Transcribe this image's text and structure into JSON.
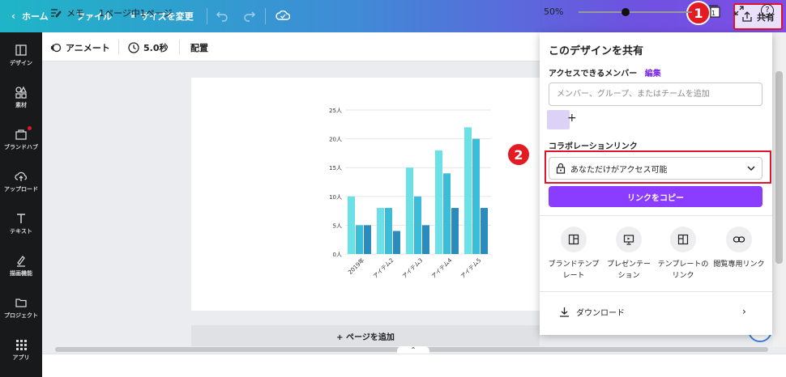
{
  "topbar": {
    "home": "ホーム",
    "file": "ファイル",
    "resize": "サイズを変更",
    "share": "共有",
    "badge1": "1",
    "badge2": "2"
  },
  "sidebar": {
    "items": [
      {
        "label": "デザイン",
        "icon": "layout-icon"
      },
      {
        "label": "素材",
        "icon": "shapes-icon"
      },
      {
        "label": "ブランドハブ",
        "icon": "brand-icon"
      },
      {
        "label": "アップロード",
        "icon": "upload-icon"
      },
      {
        "label": "テキスト",
        "icon": "text-icon"
      },
      {
        "label": "描画機能",
        "icon": "draw-icon"
      },
      {
        "label": "プロジェクト",
        "icon": "folder-icon"
      },
      {
        "label": "アプリ",
        "icon": "apps-icon"
      }
    ]
  },
  "subbar": {
    "animate": "アニメート",
    "duration": "5.0秒",
    "arrange": "配置"
  },
  "canvas": {
    "add_page": "+ ページを追加"
  },
  "bottombar": {
    "notes": "メモ",
    "page_info": "1ページ中1ページ",
    "zoom": "50%",
    "page_count": "1",
    "help": "?"
  },
  "share_panel": {
    "title": "このデザインを共有",
    "access_label": "アクセスできるメンバー",
    "edit_link": "編集",
    "search_placeholder": "メンバー、グループ、またはチームを追加",
    "collab_label": "コラボレーションリンク",
    "access_value": "あなただけがアクセス可能",
    "copy_button": "リンクをコピー",
    "options": [
      {
        "line1": "ブランドテンプ",
        "line2": "レート",
        "icon": "template-icon"
      },
      {
        "line1": "プレゼンテー",
        "line2": "ション",
        "icon": "present-icon"
      },
      {
        "line1": "テンプレートの",
        "line2": "リンク",
        "icon": "template-link-icon"
      },
      {
        "line1": "閲覧専用リンク",
        "line2": "",
        "icon": "link-icon"
      }
    ],
    "download": "ダウンロード"
  },
  "chart_data": {
    "type": "bar",
    "categories": [
      "2019年",
      "アイテム2",
      "アイテム3",
      "アイテム4",
      "アイテム5"
    ],
    "series": [
      {
        "values": [
          10,
          8,
          15,
          18,
          22
        ]
      },
      {
        "values": [
          5,
          8,
          10,
          14,
          20
        ]
      },
      {
        "values": [
          5,
          4,
          5,
          8,
          8
        ]
      }
    ],
    "colors": [
      "#6be0e6",
      "#3bbcd8",
      "#2a8bbd"
    ],
    "yticks": [
      "0人",
      "5人",
      "10人",
      "15人",
      "20人",
      "25人"
    ],
    "ylim": [
      0,
      25
    ],
    "grid": true
  }
}
